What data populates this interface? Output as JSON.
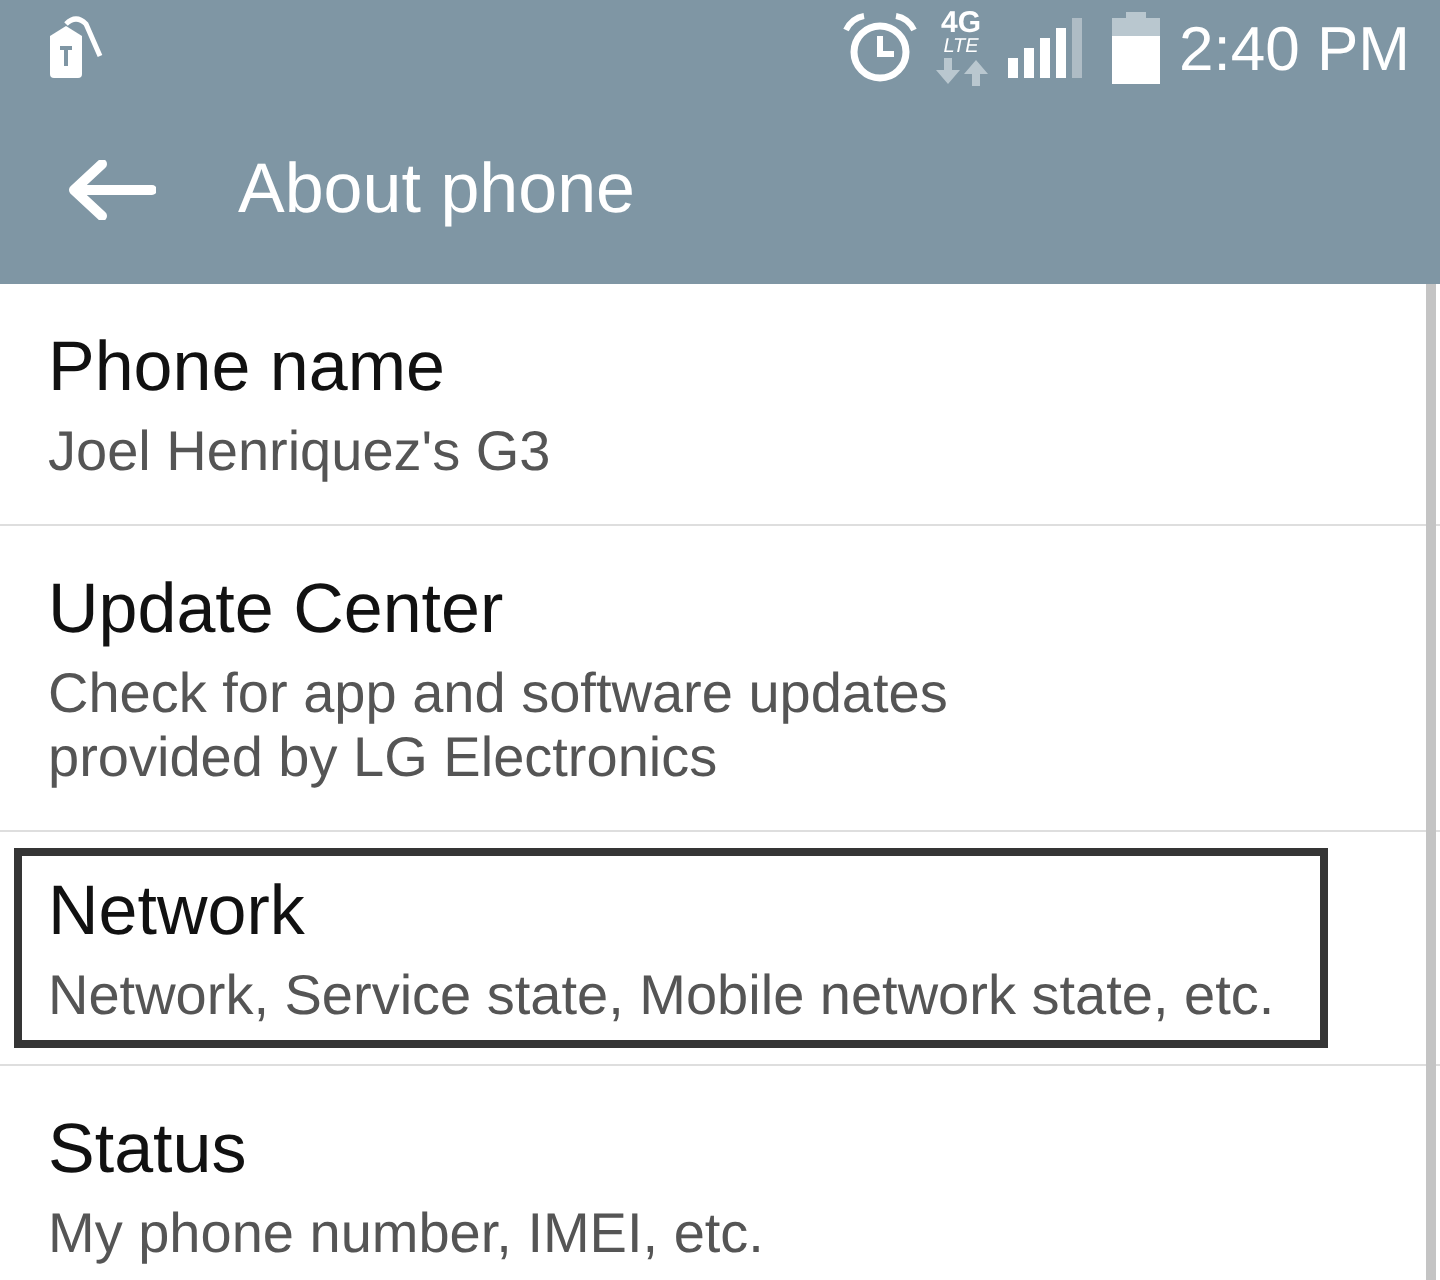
{
  "status_bar": {
    "network_type": "4G",
    "network_subtype": "LTE",
    "time": "2:40 PM"
  },
  "toolbar": {
    "title": "About phone"
  },
  "items": [
    {
      "title": "Phone name",
      "subtitle": "Joel Henriquez's G3",
      "highlighted": false
    },
    {
      "title": "Update Center",
      "subtitle": "Check for app and software updates\nprovided by LG Electronics",
      "highlighted": false
    },
    {
      "title": "Network",
      "subtitle": "Network, Service state, Mobile network state, etc.",
      "highlighted": true
    },
    {
      "title": "Status",
      "subtitle": "My phone number, IMEI, etc.",
      "highlighted": false
    }
  ]
}
